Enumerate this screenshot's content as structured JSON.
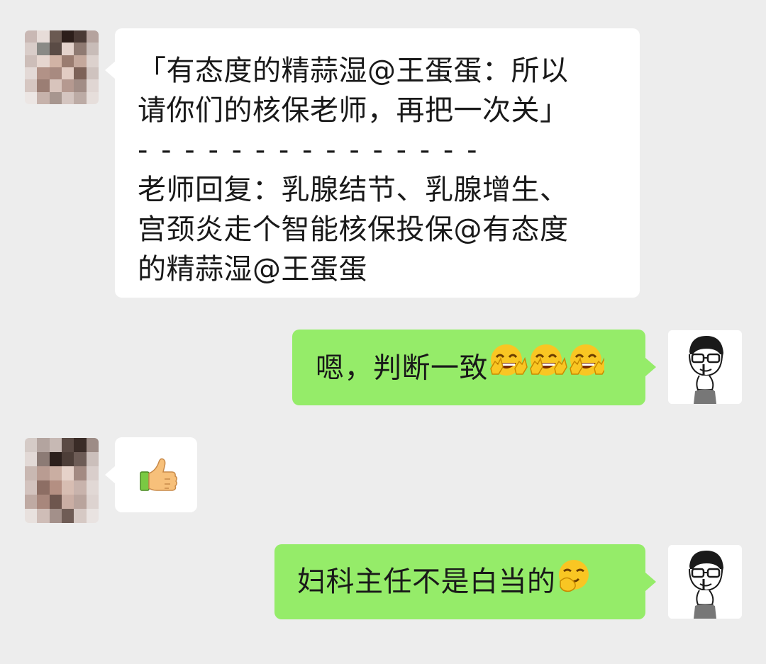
{
  "messages": [
    {
      "sender": "other",
      "quote_lines": [
        "「有态度的精蒜湿@王蛋蛋：所以",
        "请你们的核保老师，再把一次关」"
      ],
      "divider": "- - - - - - - - - - - - - - -",
      "reply_lines": [
        "老师回复：乳腺结节、乳腺增生、",
        "宫颈炎走个智能核保投保@有态度",
        "的精蒜湿@王蛋蛋"
      ]
    },
    {
      "sender": "self",
      "text": "嗯，判断一致",
      "emojis": [
        "grin-peace-emoji",
        "grin-peace-emoji",
        "grin-peace-emoji"
      ]
    },
    {
      "sender": "other",
      "emoji": "thumbs-up-emoji"
    },
    {
      "sender": "self",
      "text": "妇科主任不是白当的",
      "emojis": [
        "smirk-emoji"
      ]
    }
  ],
  "colors": {
    "background": "#ededed",
    "incoming_bubble": "#ffffff",
    "outgoing_bubble": "#95ec69"
  }
}
